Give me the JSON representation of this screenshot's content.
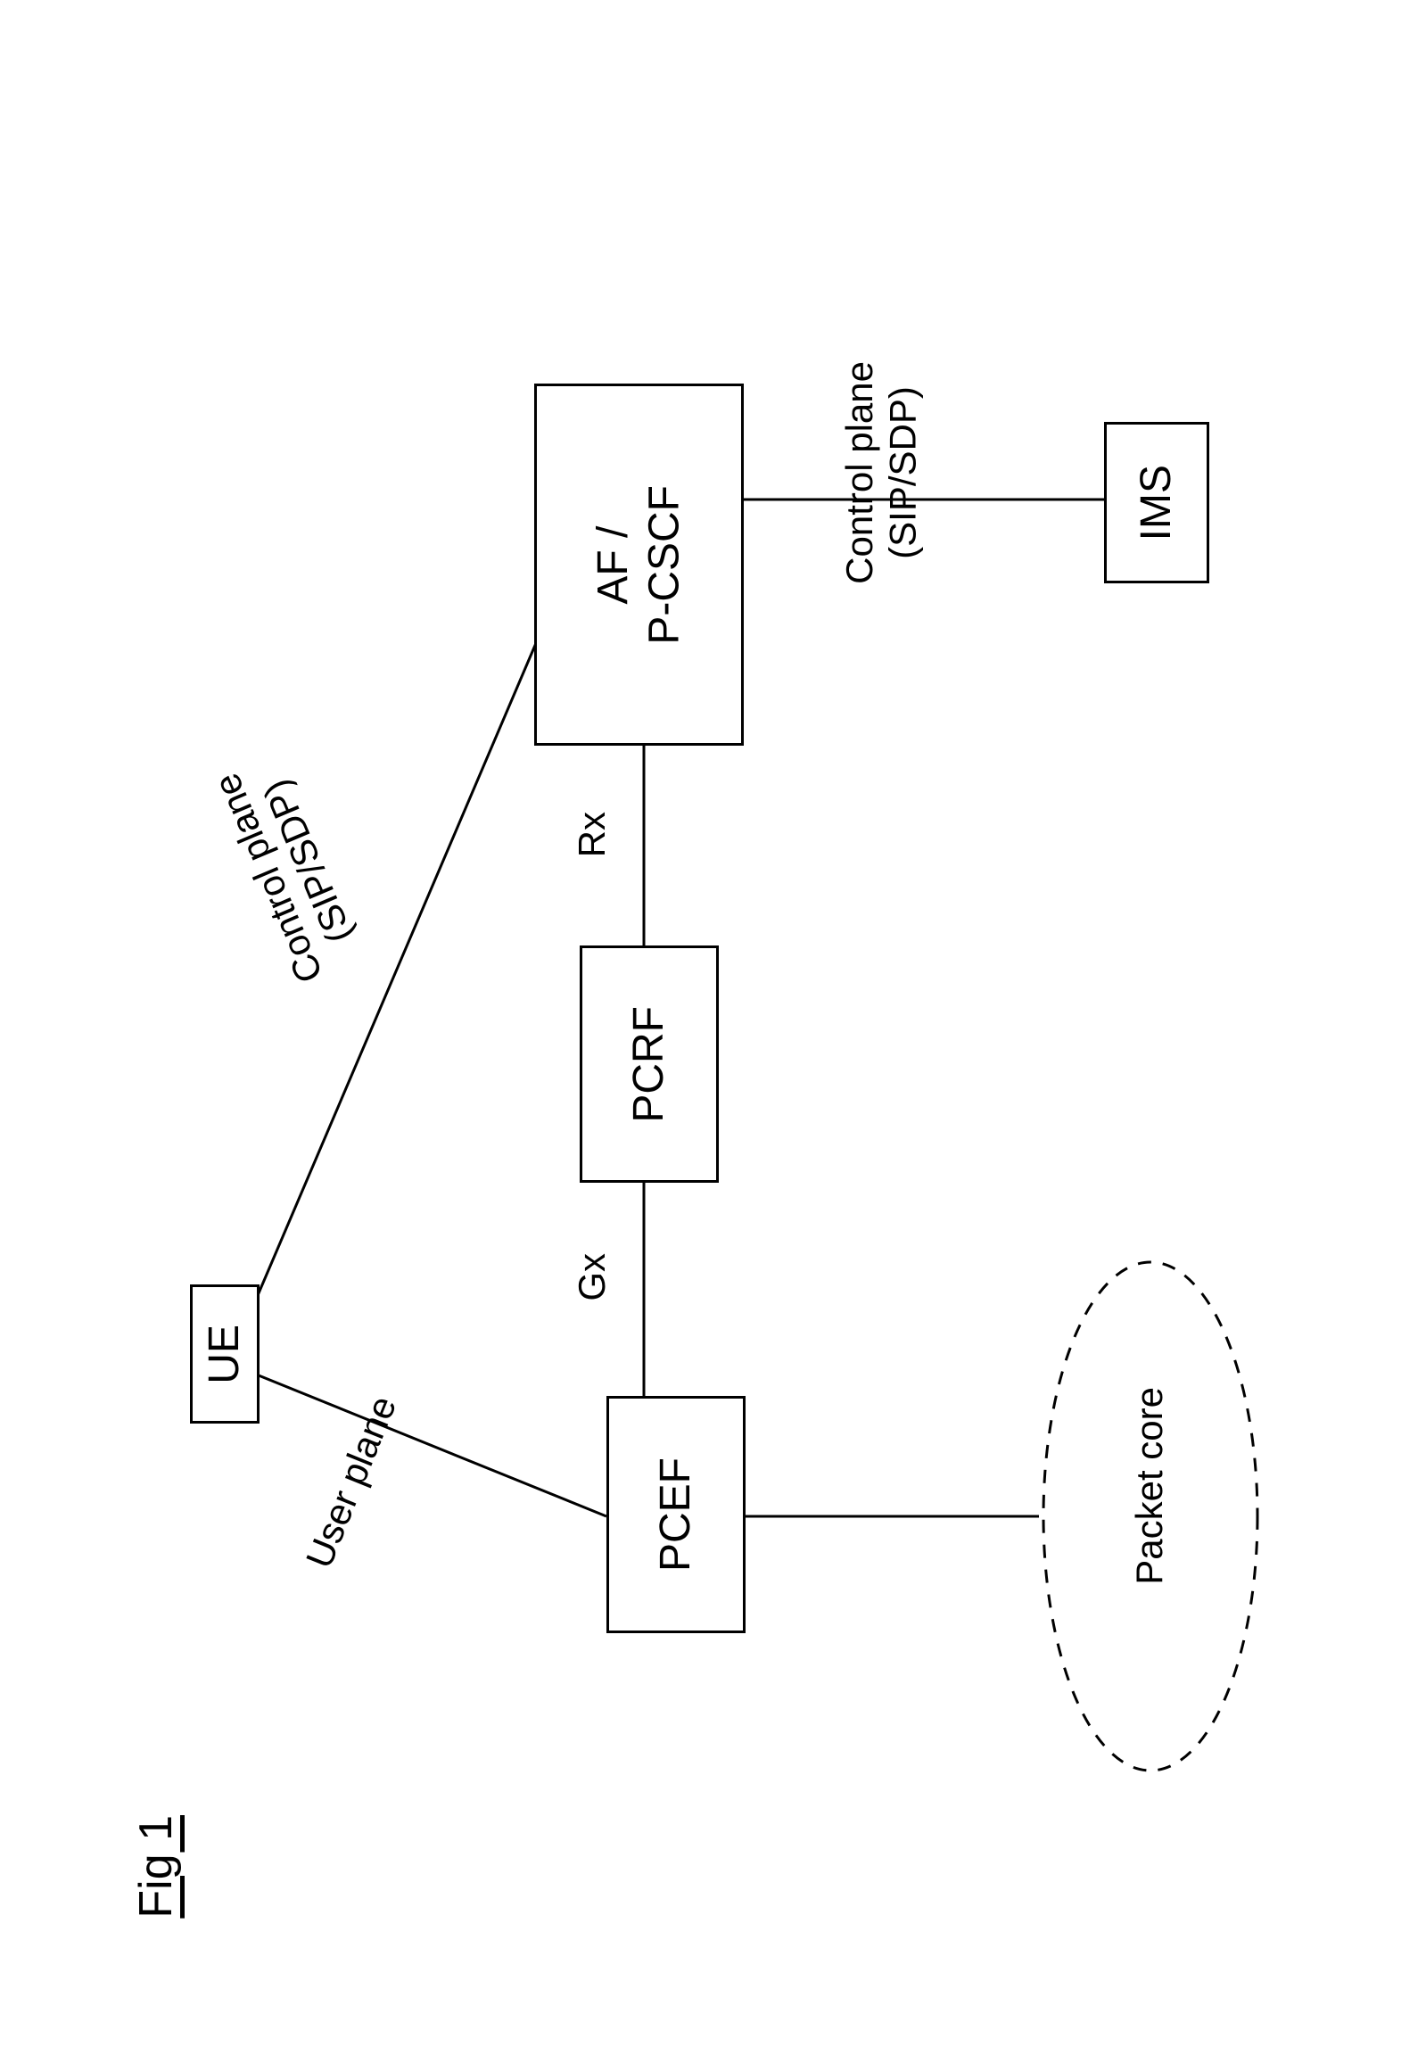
{
  "nodes": {
    "ue": "UE",
    "af_pcscf": "AF /\nP-CSCF",
    "ims": "IMS",
    "pcrf": "PCRF",
    "pcef": "PCEF",
    "packet_core": "Packet core"
  },
  "edges": {
    "ue_af": "Control plane\n(SIP/SDP)",
    "af_ims": "Control plane\n(SIP/SDP)",
    "af_pcrf": "Rx",
    "pcrf_pcef": "Gx",
    "ue_pcef": "User plane"
  },
  "figure_label": "Fig 1"
}
